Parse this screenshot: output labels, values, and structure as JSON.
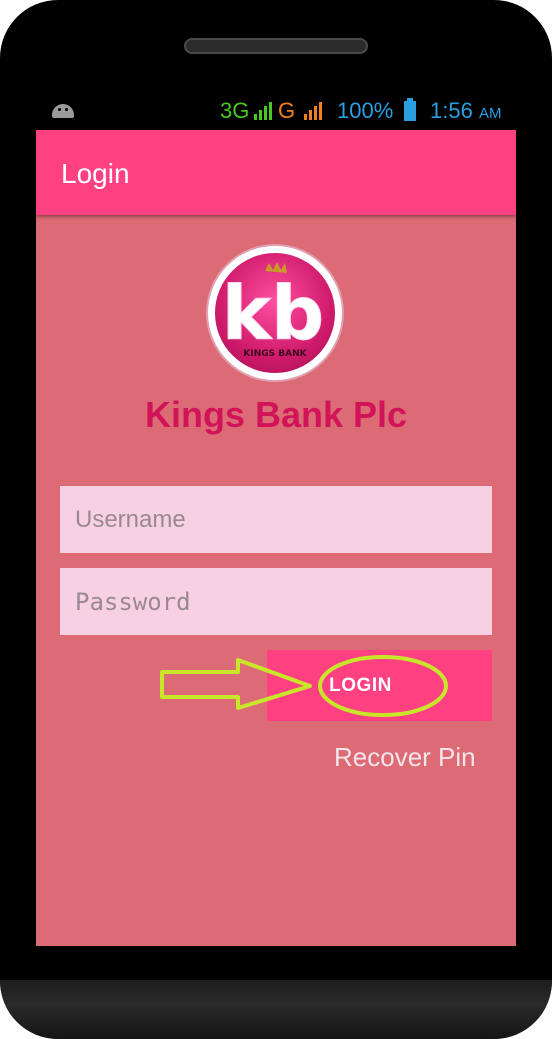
{
  "status_bar": {
    "network_3g": "3G",
    "network_g": "G",
    "battery": "100%",
    "time": "1:56",
    "ampm": "AM"
  },
  "app_bar": {
    "title": "Login"
  },
  "logo": {
    "letters": "kb",
    "text": "KINGS BANK"
  },
  "bank_name": "Kings Bank Plc",
  "form": {
    "username_placeholder": "Username",
    "password_placeholder": "Password",
    "login_label": "LOGIN",
    "recover_label": "Recover Pin"
  },
  "colors": {
    "app_bar": "#ff4081",
    "background": "#dd6b75",
    "brand_text": "#d1145a",
    "field_bg": "#f8d0e4",
    "annotation": "#c8e62a"
  }
}
